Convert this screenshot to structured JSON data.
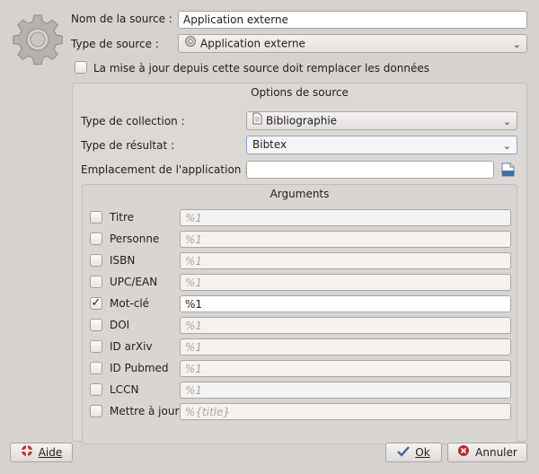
{
  "source_name": {
    "label": "Nom de la source :",
    "value": "Application externe"
  },
  "source_type": {
    "label": "Type de source :",
    "value": "Application externe",
    "icon": "gear-icon"
  },
  "replace_data": {
    "label": "La mise à jour depuis cette source doit remplacer les données",
    "checked": false
  },
  "options": {
    "title": "Options de source",
    "collection_type": {
      "label": "Type de collection :",
      "value": "Bibliographie",
      "icon": "document-icon"
    },
    "result_type": {
      "label": "Type de résultat :",
      "value": "Bibtex"
    },
    "app_location": {
      "label": "Emplacement de l'application :",
      "value": ""
    }
  },
  "arguments": {
    "title": "Arguments",
    "rows": [
      {
        "label": "Titre",
        "value": "%1",
        "checked": false,
        "enabled": false
      },
      {
        "label": "Personne",
        "value": "%1",
        "checked": false,
        "enabled": false
      },
      {
        "label": "ISBN",
        "value": "%1",
        "checked": false,
        "enabled": false
      },
      {
        "label": "UPC/EAN",
        "value": "%1",
        "checked": false,
        "enabled": false
      },
      {
        "label": "Mot-clé",
        "value": "%1",
        "checked": true,
        "enabled": true
      },
      {
        "label": "DOI",
        "value": "%1",
        "checked": false,
        "enabled": false
      },
      {
        "label": "ID arXiv",
        "value": "%1",
        "checked": false,
        "enabled": false
      },
      {
        "label": "ID Pubmed",
        "value": "%1",
        "checked": false,
        "enabled": false
      },
      {
        "label": "LCCN",
        "value": "%1",
        "checked": false,
        "enabled": false
      },
      {
        "label": "Mettre à jour",
        "value": "%{title}",
        "checked": false,
        "enabled": false
      }
    ]
  },
  "buttons": {
    "help": "Aide",
    "ok": "Ok",
    "cancel": "Annuler"
  },
  "colors": {
    "accent_focus": "#7fa7cf",
    "check_green": "#2e7d32",
    "cancel_red": "#c0262d"
  }
}
